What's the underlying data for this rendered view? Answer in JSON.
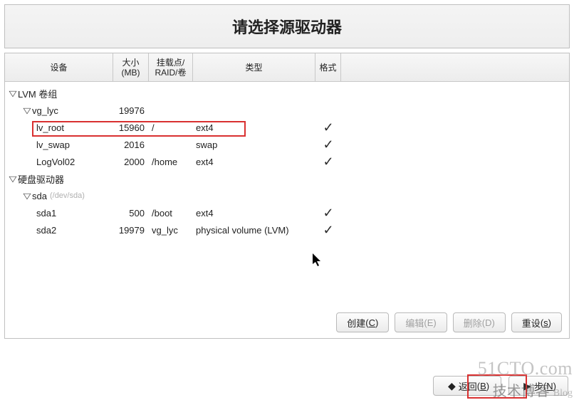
{
  "title": "请选择源驱动器",
  "headers": {
    "device": "设备",
    "size": "大小\n(MB)",
    "mount": "挂载点/\nRAID/卷",
    "type": "类型",
    "fmt": "格式"
  },
  "tree": {
    "lvm_label": "LVM 卷组",
    "vg": {
      "name": "vg_lyc",
      "size": "19976"
    },
    "lvs": [
      {
        "name": "lv_root",
        "size": "15960",
        "mount": "/",
        "type": "ext4",
        "check": true
      },
      {
        "name": "lv_swap",
        "size": "2016",
        "mount": "",
        "type": "swap",
        "check": true
      },
      {
        "name": "LogVol02",
        "size": "2000",
        "mount": "/home",
        "type": "ext4",
        "check": true
      }
    ],
    "hdd_label": "硬盘驱动器",
    "disk": {
      "name": "sda",
      "hint": "(/dev/sda)"
    },
    "parts": [
      {
        "name": "sda1",
        "size": "500",
        "mount": "/boot",
        "type": "ext4",
        "check": true
      },
      {
        "name": "sda2",
        "size": "19979",
        "mount": "vg_lyc",
        "type": "physical volume (LVM)",
        "check": true
      }
    ]
  },
  "buttons": {
    "create": "创建",
    "edit": "编辑",
    "delete": "删除",
    "reset": "重设",
    "back": "返回",
    "next": "步"
  },
  "mn": {
    "create": "C",
    "edit": "E",
    "delete": "D",
    "reset": "s",
    "back": "B",
    "next": "N"
  },
  "watermark": {
    "l1": "51CTO.com",
    "l2": "技术博客",
    "l3": "Blog"
  }
}
